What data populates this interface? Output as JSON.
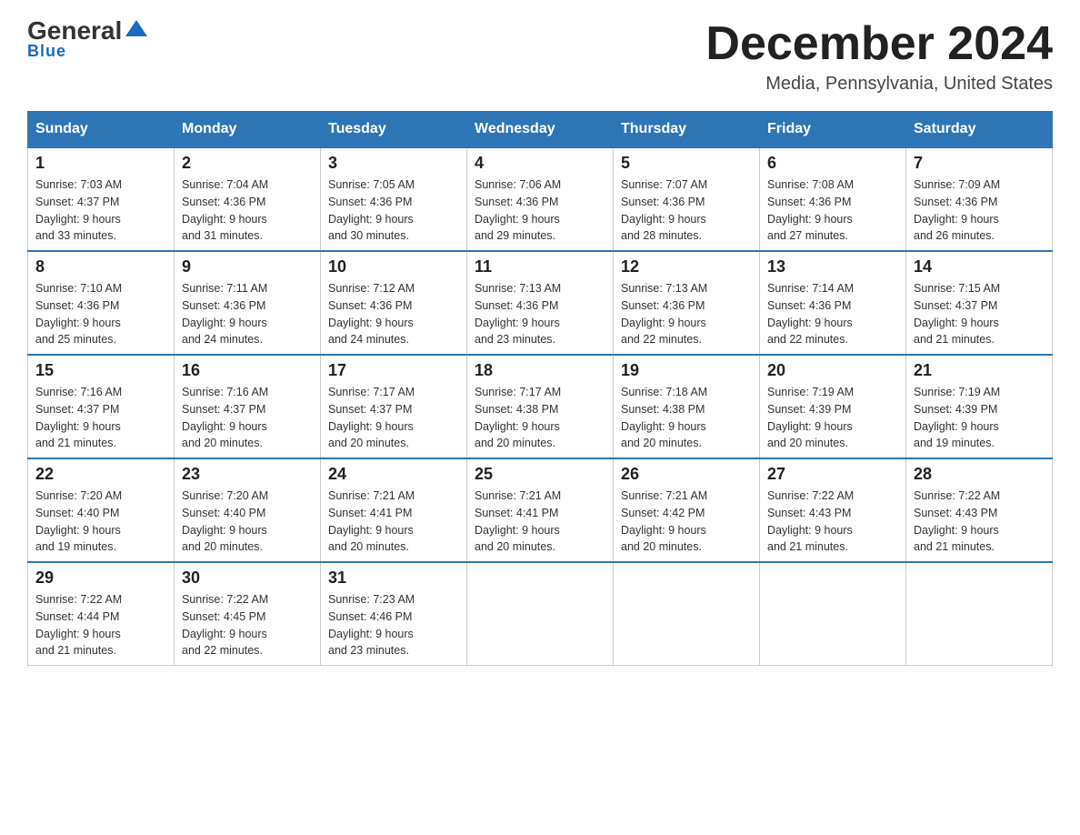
{
  "logo": {
    "general": "General",
    "blue": "Blue"
  },
  "header": {
    "title": "December 2024",
    "subtitle": "Media, Pennsylvania, United States"
  },
  "days_of_week": [
    "Sunday",
    "Monday",
    "Tuesday",
    "Wednesday",
    "Thursday",
    "Friday",
    "Saturday"
  ],
  "weeks": [
    [
      {
        "day": "1",
        "sunrise": "7:03 AM",
        "sunset": "4:37 PM",
        "daylight": "9 hours and 33 minutes."
      },
      {
        "day": "2",
        "sunrise": "7:04 AM",
        "sunset": "4:36 PM",
        "daylight": "9 hours and 31 minutes."
      },
      {
        "day": "3",
        "sunrise": "7:05 AM",
        "sunset": "4:36 PM",
        "daylight": "9 hours and 30 minutes."
      },
      {
        "day": "4",
        "sunrise": "7:06 AM",
        "sunset": "4:36 PM",
        "daylight": "9 hours and 29 minutes."
      },
      {
        "day": "5",
        "sunrise": "7:07 AM",
        "sunset": "4:36 PM",
        "daylight": "9 hours and 28 minutes."
      },
      {
        "day": "6",
        "sunrise": "7:08 AM",
        "sunset": "4:36 PM",
        "daylight": "9 hours and 27 minutes."
      },
      {
        "day": "7",
        "sunrise": "7:09 AM",
        "sunset": "4:36 PM",
        "daylight": "9 hours and 26 minutes."
      }
    ],
    [
      {
        "day": "8",
        "sunrise": "7:10 AM",
        "sunset": "4:36 PM",
        "daylight": "9 hours and 25 minutes."
      },
      {
        "day": "9",
        "sunrise": "7:11 AM",
        "sunset": "4:36 PM",
        "daylight": "9 hours and 24 minutes."
      },
      {
        "day": "10",
        "sunrise": "7:12 AM",
        "sunset": "4:36 PM",
        "daylight": "9 hours and 24 minutes."
      },
      {
        "day": "11",
        "sunrise": "7:13 AM",
        "sunset": "4:36 PM",
        "daylight": "9 hours and 23 minutes."
      },
      {
        "day": "12",
        "sunrise": "7:13 AM",
        "sunset": "4:36 PM",
        "daylight": "9 hours and 22 minutes."
      },
      {
        "day": "13",
        "sunrise": "7:14 AM",
        "sunset": "4:36 PM",
        "daylight": "9 hours and 22 minutes."
      },
      {
        "day": "14",
        "sunrise": "7:15 AM",
        "sunset": "4:37 PM",
        "daylight": "9 hours and 21 minutes."
      }
    ],
    [
      {
        "day": "15",
        "sunrise": "7:16 AM",
        "sunset": "4:37 PM",
        "daylight": "9 hours and 21 minutes."
      },
      {
        "day": "16",
        "sunrise": "7:16 AM",
        "sunset": "4:37 PM",
        "daylight": "9 hours and 20 minutes."
      },
      {
        "day": "17",
        "sunrise": "7:17 AM",
        "sunset": "4:37 PM",
        "daylight": "9 hours and 20 minutes."
      },
      {
        "day": "18",
        "sunrise": "7:17 AM",
        "sunset": "4:38 PM",
        "daylight": "9 hours and 20 minutes."
      },
      {
        "day": "19",
        "sunrise": "7:18 AM",
        "sunset": "4:38 PM",
        "daylight": "9 hours and 20 minutes."
      },
      {
        "day": "20",
        "sunrise": "7:19 AM",
        "sunset": "4:39 PM",
        "daylight": "9 hours and 20 minutes."
      },
      {
        "day": "21",
        "sunrise": "7:19 AM",
        "sunset": "4:39 PM",
        "daylight": "9 hours and 19 minutes."
      }
    ],
    [
      {
        "day": "22",
        "sunrise": "7:20 AM",
        "sunset": "4:40 PM",
        "daylight": "9 hours and 19 minutes."
      },
      {
        "day": "23",
        "sunrise": "7:20 AM",
        "sunset": "4:40 PM",
        "daylight": "9 hours and 20 minutes."
      },
      {
        "day": "24",
        "sunrise": "7:21 AM",
        "sunset": "4:41 PM",
        "daylight": "9 hours and 20 minutes."
      },
      {
        "day": "25",
        "sunrise": "7:21 AM",
        "sunset": "4:41 PM",
        "daylight": "9 hours and 20 minutes."
      },
      {
        "day": "26",
        "sunrise": "7:21 AM",
        "sunset": "4:42 PM",
        "daylight": "9 hours and 20 minutes."
      },
      {
        "day": "27",
        "sunrise": "7:22 AM",
        "sunset": "4:43 PM",
        "daylight": "9 hours and 21 minutes."
      },
      {
        "day": "28",
        "sunrise": "7:22 AM",
        "sunset": "4:43 PM",
        "daylight": "9 hours and 21 minutes."
      }
    ],
    [
      {
        "day": "29",
        "sunrise": "7:22 AM",
        "sunset": "4:44 PM",
        "daylight": "9 hours and 21 minutes."
      },
      {
        "day": "30",
        "sunrise": "7:22 AM",
        "sunset": "4:45 PM",
        "daylight": "9 hours and 22 minutes."
      },
      {
        "day": "31",
        "sunrise": "7:23 AM",
        "sunset": "4:46 PM",
        "daylight": "9 hours and 23 minutes."
      },
      null,
      null,
      null,
      null
    ]
  ],
  "labels": {
    "sunrise": "Sunrise: ",
    "sunset": "Sunset: ",
    "daylight": "Daylight: "
  }
}
